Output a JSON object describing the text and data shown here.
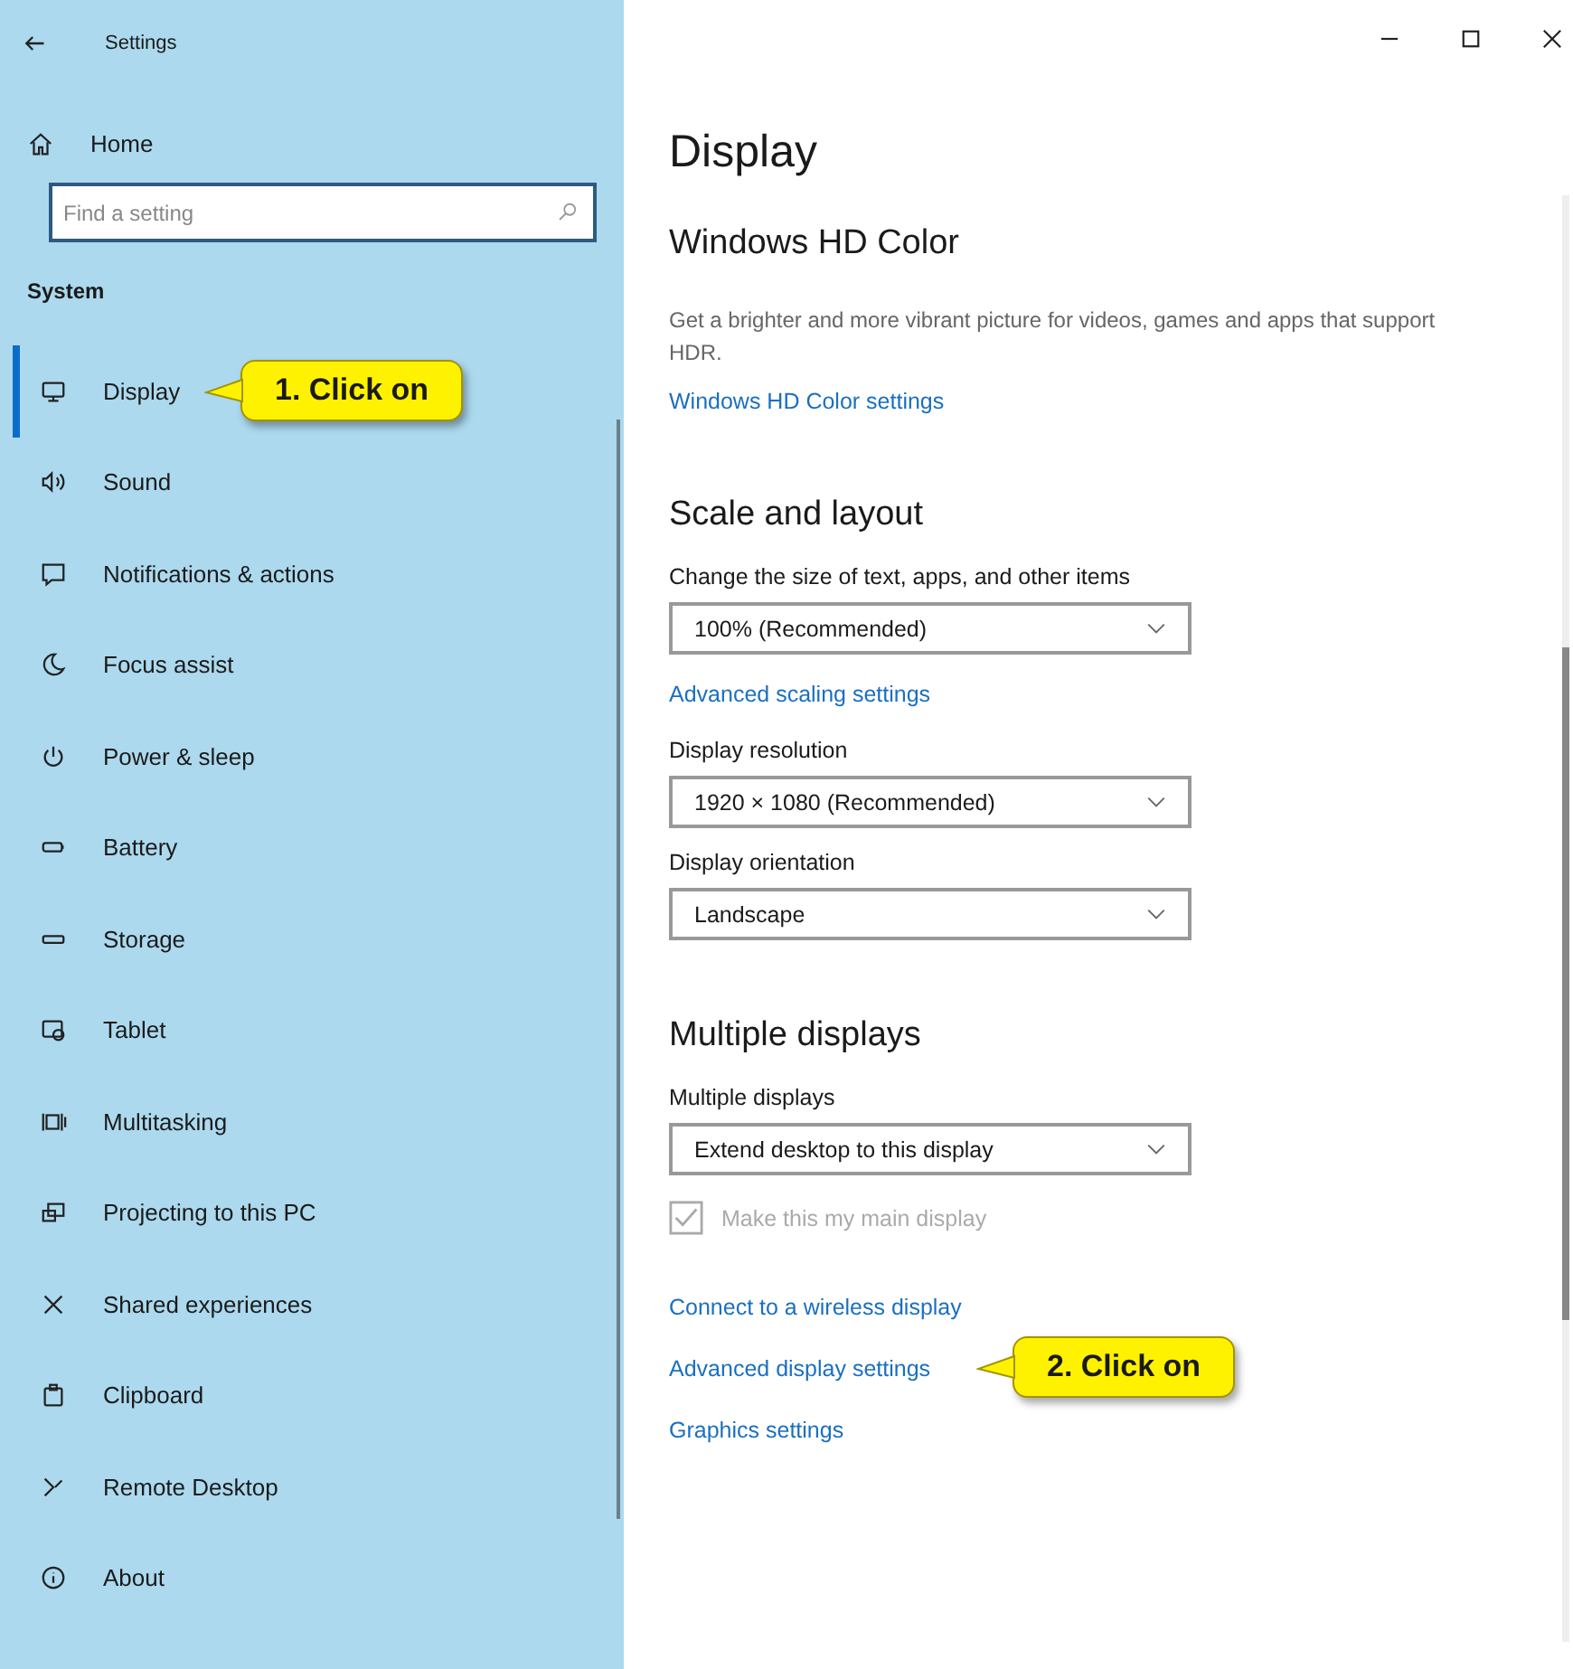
{
  "window": {
    "title": "Settings"
  },
  "sidebar": {
    "home": "Home",
    "search": {
      "placeholder": "Find a setting"
    },
    "section": "System",
    "items": [
      {
        "label": "Display",
        "selected": true,
        "callout": "1. Click on"
      },
      {
        "label": "Sound",
        "selected": false
      },
      {
        "label": "Notifications & actions",
        "selected": false
      },
      {
        "label": "Focus assist",
        "selected": false
      },
      {
        "label": "Power & sleep",
        "selected": false
      },
      {
        "label": "Battery",
        "selected": false
      },
      {
        "label": "Storage",
        "selected": false
      },
      {
        "label": "Tablet",
        "selected": false
      },
      {
        "label": "Multitasking",
        "selected": false
      },
      {
        "label": "Projecting to this PC",
        "selected": false
      },
      {
        "label": "Shared experiences",
        "selected": false
      },
      {
        "label": "Clipboard",
        "selected": false
      },
      {
        "label": "Remote Desktop",
        "selected": false
      },
      {
        "label": "About",
        "selected": false
      }
    ]
  },
  "page": {
    "title": "Display",
    "sections": [
      {
        "heading": "Windows HD Color",
        "items": [
          {
            "kind": "text",
            "text": "Get a brighter and more vibrant picture for videos, games and apps that support HDR."
          },
          {
            "kind": "link",
            "text": "Windows HD Color settings"
          }
        ]
      },
      {
        "heading": "Scale and layout",
        "items": [
          {
            "kind": "dropdown",
            "label": "Change the size of text, apps, and other items",
            "value": "100% (Recommended)"
          },
          {
            "kind": "link",
            "text": "Advanced scaling settings"
          },
          {
            "kind": "dropdown",
            "label": "Display resolution",
            "value": "1920 × 1080 (Recommended)"
          },
          {
            "kind": "dropdown",
            "label": "Display orientation",
            "value": "Landscape"
          }
        ]
      },
      {
        "heading": "Multiple displays",
        "items": [
          {
            "kind": "dropdown",
            "label": "Multiple displays",
            "value": "Extend desktop to this display"
          },
          {
            "kind": "checkbox",
            "label": "Make this my main display",
            "checked": true,
            "disabled": true
          },
          {
            "kind": "link",
            "text": "Connect to a wireless display"
          },
          {
            "kind": "link",
            "text": "Advanced display settings",
            "callout": "2. Click on"
          },
          {
            "kind": "link",
            "text": "Graphics settings"
          }
        ]
      }
    ]
  }
}
